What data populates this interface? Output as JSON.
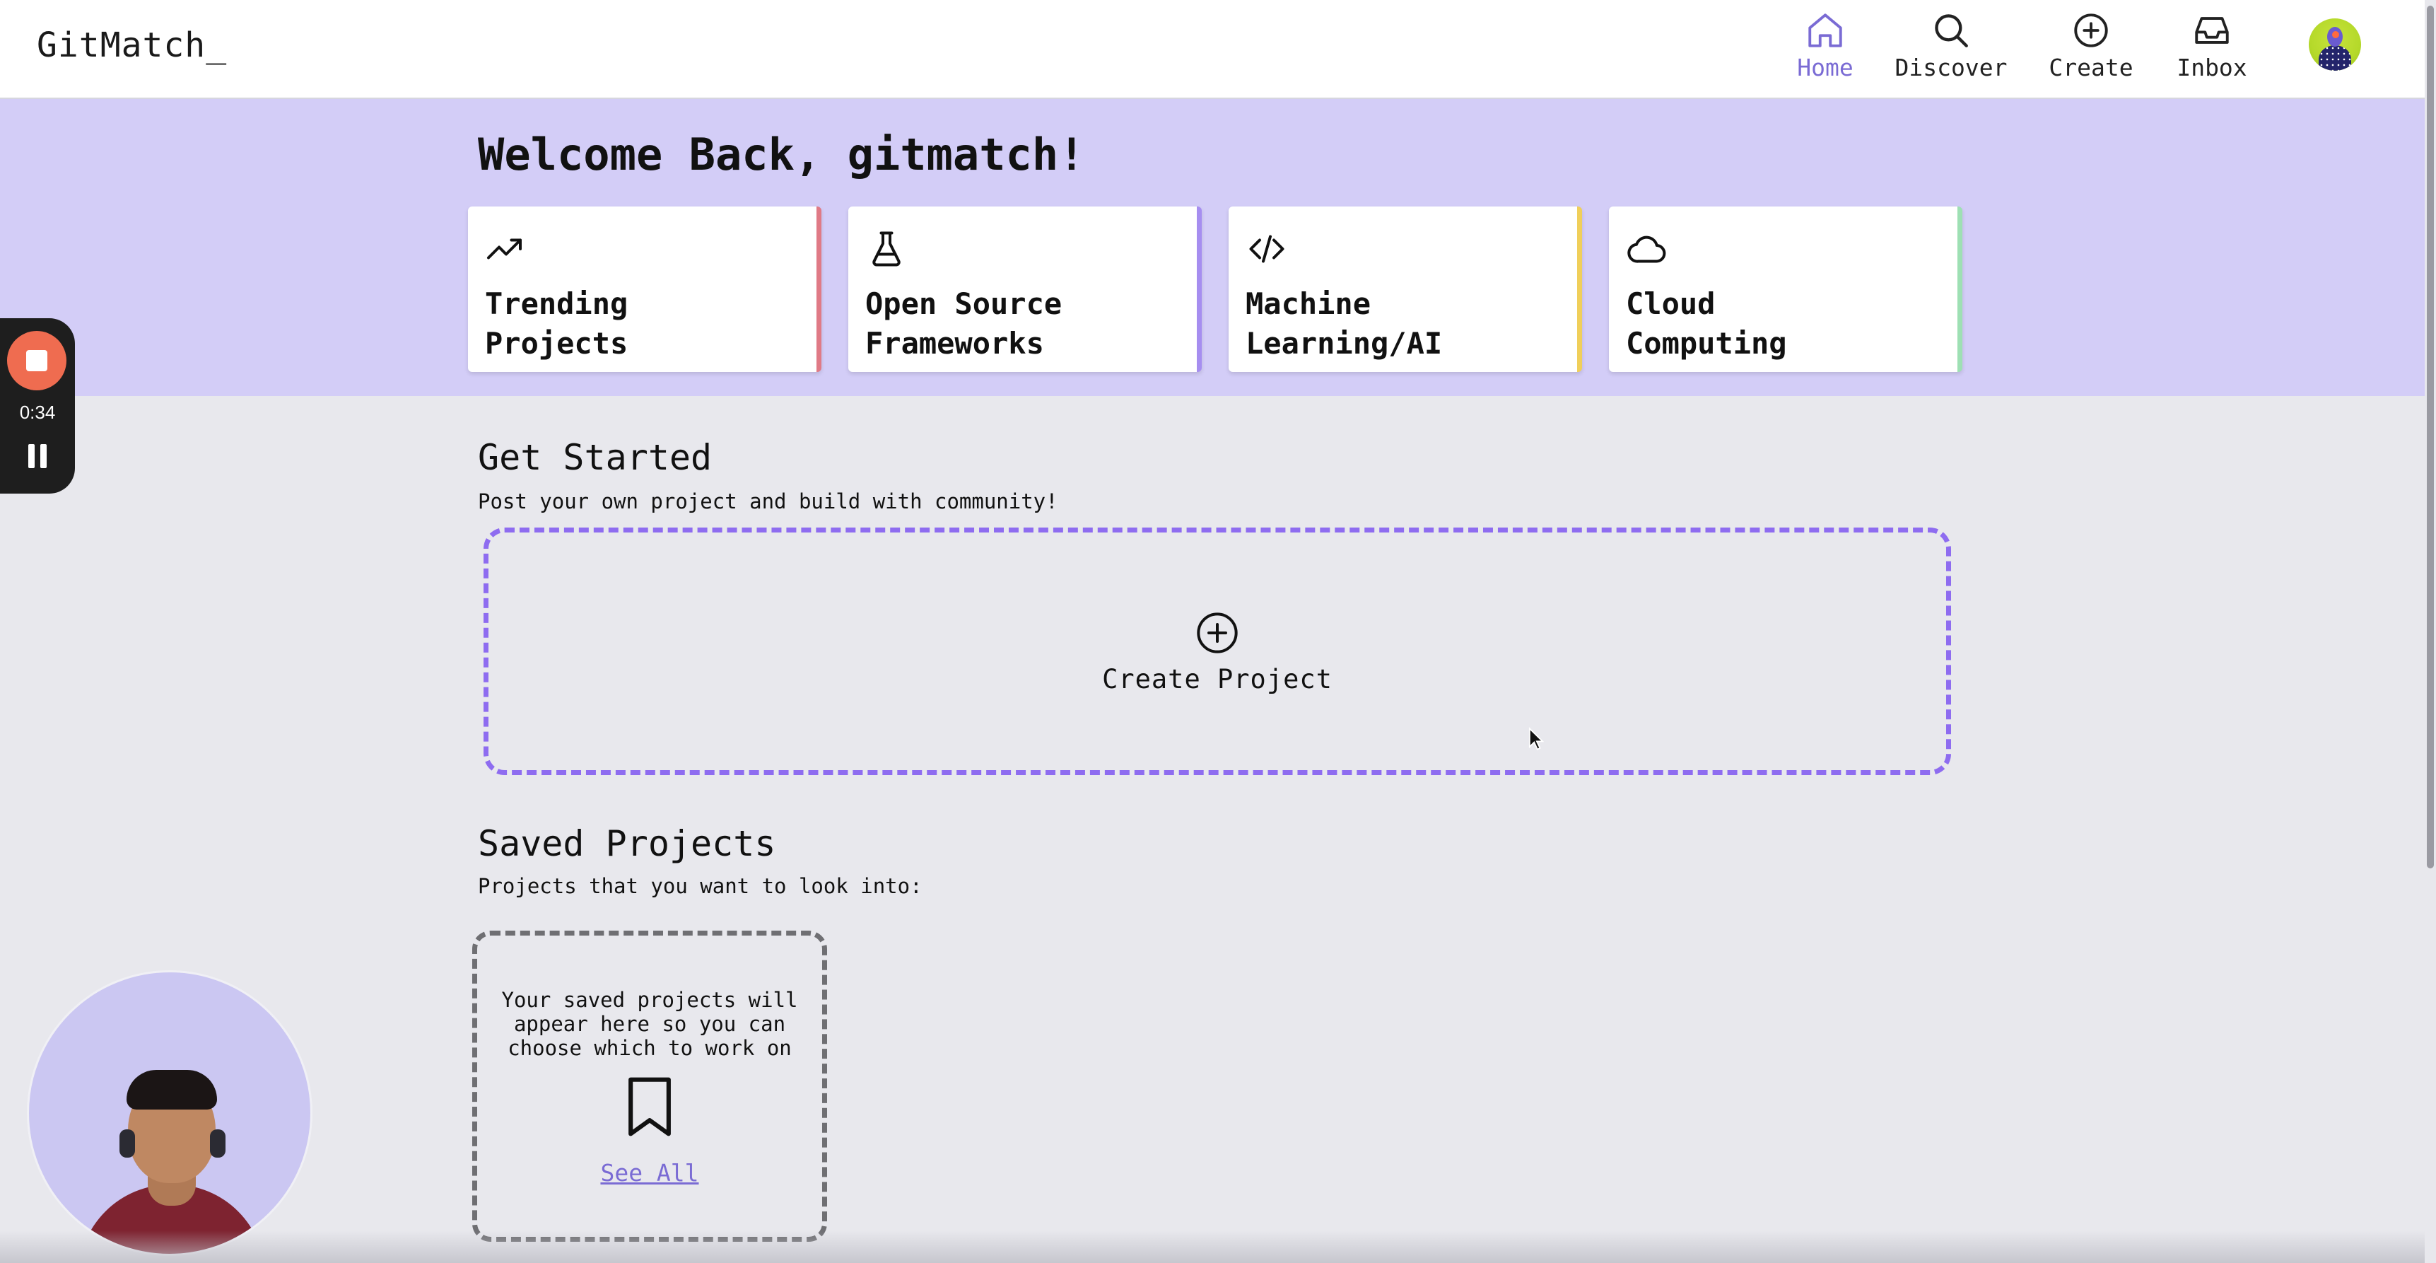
{
  "app": {
    "logo": "GitMatch_"
  },
  "nav": {
    "items": [
      {
        "label": "Home",
        "icon": "home-icon",
        "active": true
      },
      {
        "label": "Discover",
        "icon": "search-icon",
        "active": false
      },
      {
        "label": "Create",
        "icon": "plus-circle-icon",
        "active": false
      },
      {
        "label": "Inbox",
        "icon": "inbox-icon",
        "active": false
      }
    ]
  },
  "hero": {
    "welcome": "Welcome Back, gitmatch!",
    "categories": [
      {
        "label": "Trending\nProjects",
        "icon": "trending-up-icon",
        "accent": "#e07a86"
      },
      {
        "label": "Open Source\nFrameworks",
        "icon": "flask-icon",
        "accent": "#a68ef0"
      },
      {
        "label": "Machine\nLearning/AI",
        "icon": "code-icon",
        "accent": "#f0cf5a"
      },
      {
        "label": "Cloud\nComputing",
        "icon": "cloud-icon",
        "accent": "#9ee0b4"
      }
    ]
  },
  "get_started": {
    "title": "Get Started",
    "subtitle": "Post your own project and build with community!",
    "create_label": "Create Project"
  },
  "saved": {
    "title": "Saved Projects",
    "subtitle": "Projects that you want to look into:",
    "empty_message": "Your saved projects will\nappear here so you can\nchoose which to work on",
    "see_all": "See All"
  },
  "recorder": {
    "time": "0:34"
  },
  "colors": {
    "accent": "#7a6bd4",
    "hero_bg": "#d3cdf7",
    "dashed_border": "#8e6cf0",
    "page_bg": "#e8e8ed"
  }
}
